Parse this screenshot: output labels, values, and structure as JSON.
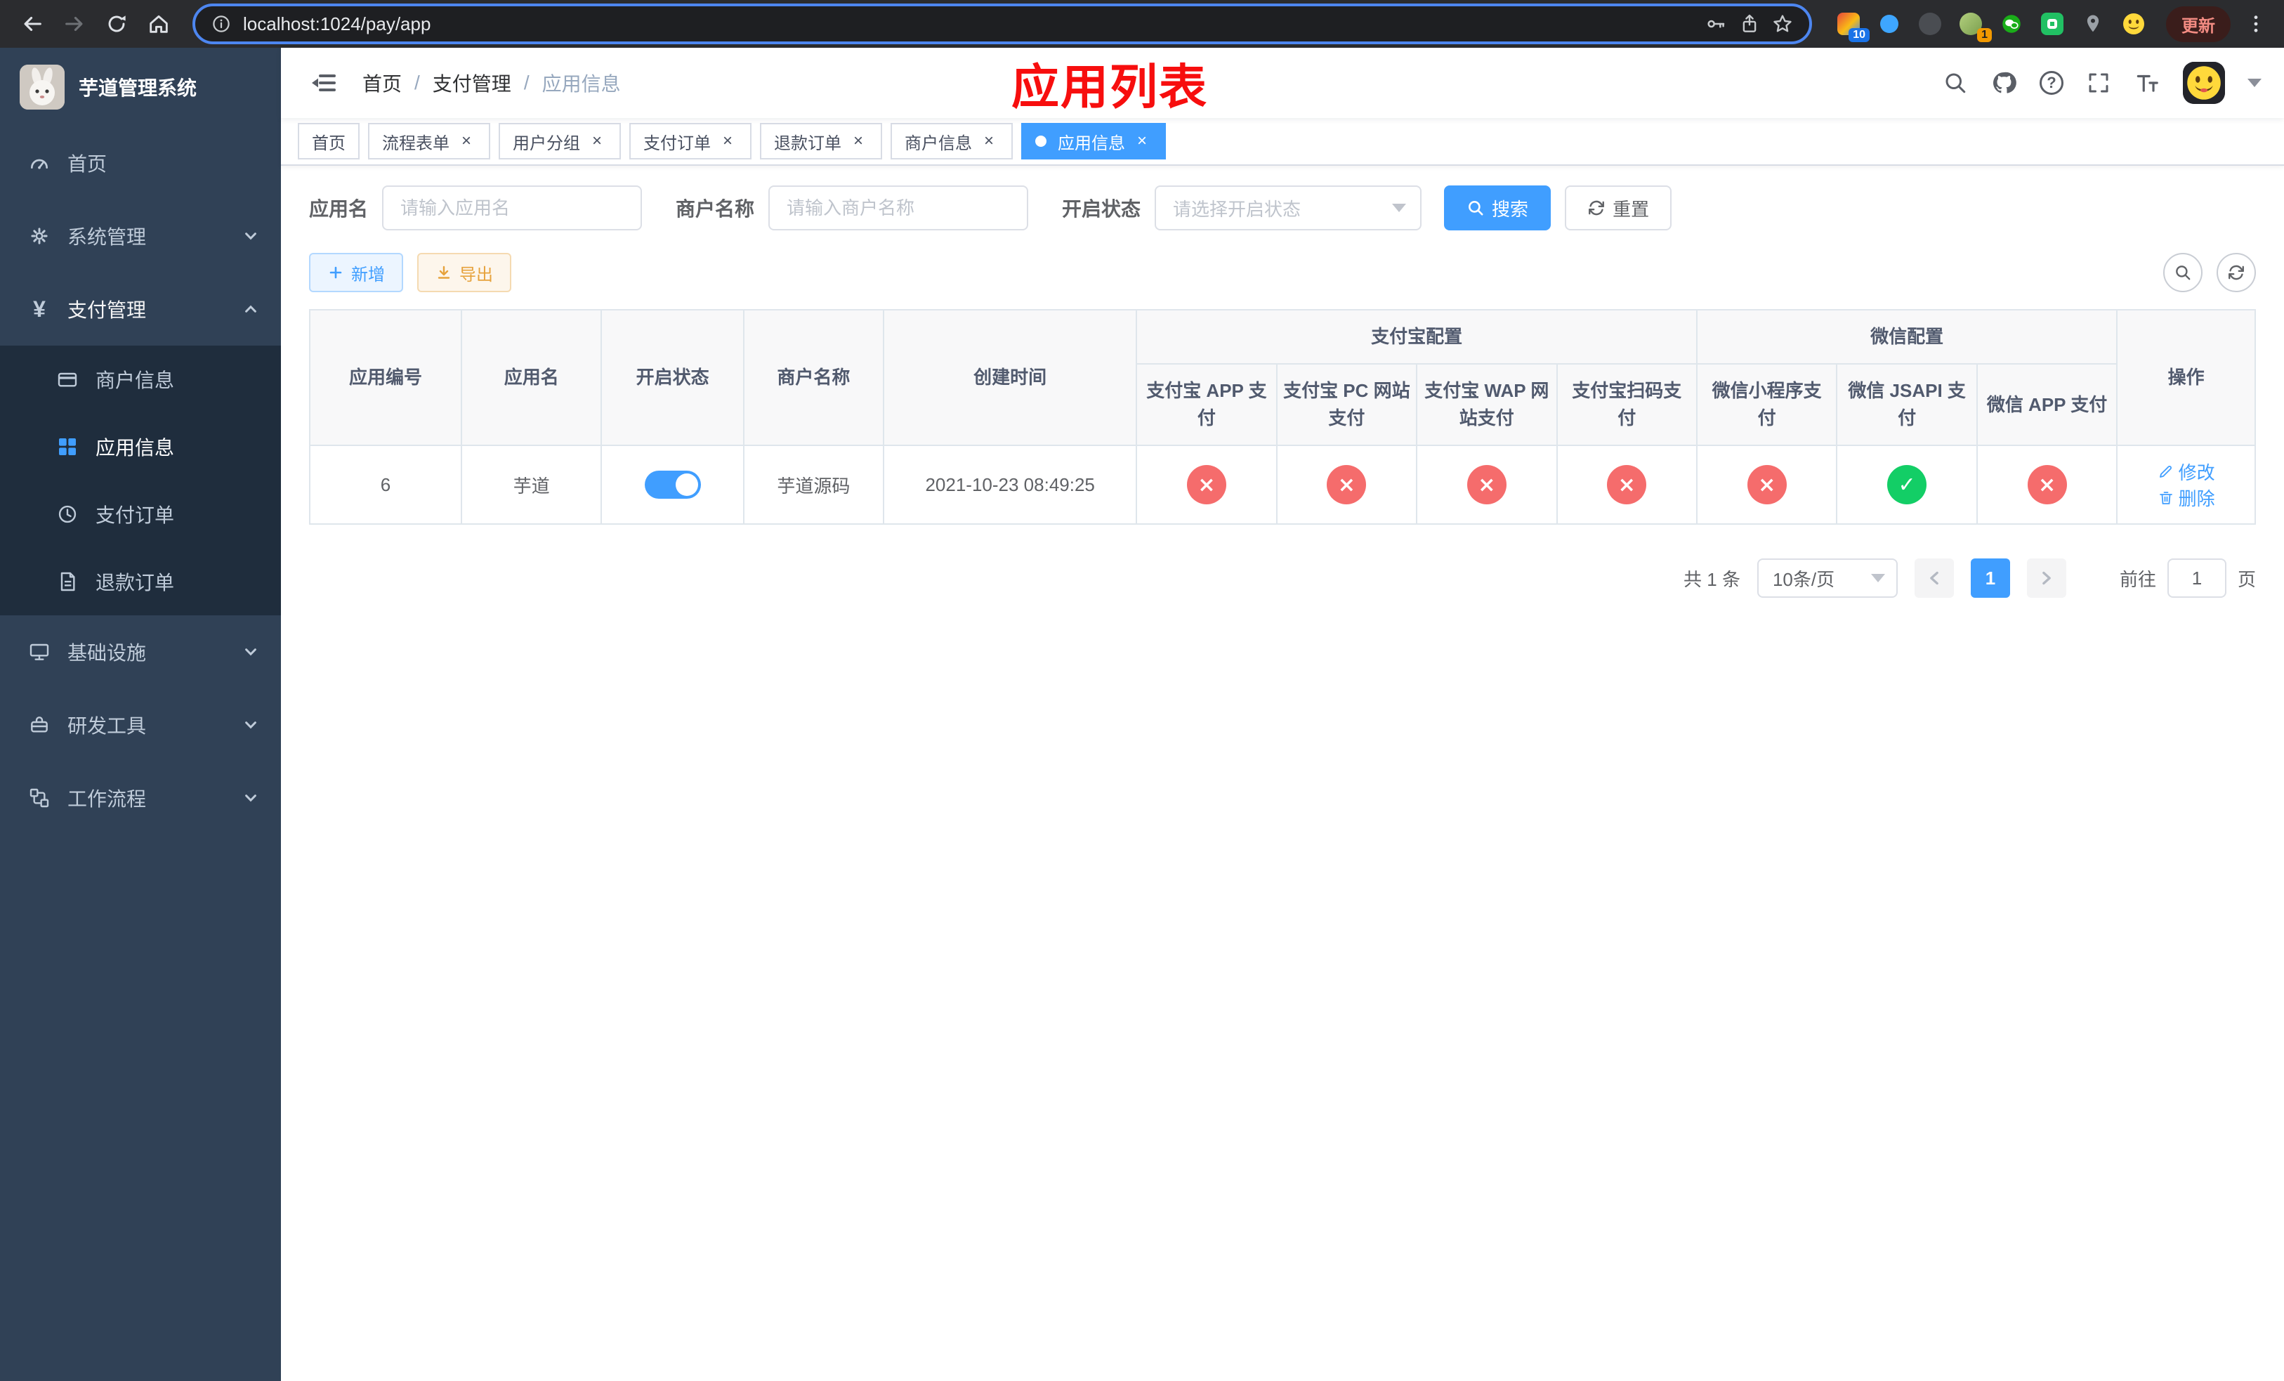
{
  "colors": {
    "accent": "#409eff",
    "success": "#13ce66",
    "danger": "#f56c6c",
    "warning": "#e6a23c",
    "sidebar": "#304156",
    "submenu": "#1f2d3d"
  },
  "icons": {
    "close": "×",
    "check": "✓",
    "cross": "×",
    "question": "?",
    "yen": "¥"
  },
  "browser": {
    "url": "localhost:1024/pay/app",
    "update_label": "更新",
    "extension_badge_count": "10",
    "profile_badge_count": "1"
  },
  "sidebar": {
    "title": "芋道管理系统",
    "items": [
      {
        "label": "首页"
      },
      {
        "label": "系统管理"
      },
      {
        "label": "支付管理",
        "children": [
          {
            "label": "商户信息"
          },
          {
            "label": "应用信息"
          },
          {
            "label": "支付订单"
          },
          {
            "label": "退款订单"
          }
        ]
      },
      {
        "label": "基础设施"
      },
      {
        "label": "研发工具"
      },
      {
        "label": "工作流程"
      }
    ]
  },
  "navbar": {
    "breadcrumb": [
      {
        "label": "首页"
      },
      {
        "label": "支付管理"
      },
      {
        "label": "应用信息"
      }
    ],
    "breadcrumb_separator": "/",
    "annotation": "应用列表"
  },
  "tabs": [
    {
      "label": "首页"
    },
    {
      "label": "流程表单"
    },
    {
      "label": "用户分组"
    },
    {
      "label": "支付订单"
    },
    {
      "label": "退款订单"
    },
    {
      "label": "商户信息"
    },
    {
      "label": "应用信息"
    }
  ],
  "filters": {
    "app_name": {
      "label": "应用名",
      "placeholder": "请输入应用名"
    },
    "merchant_name": {
      "label": "商户名称",
      "placeholder": "请输入商户名称"
    },
    "status": {
      "label": "开启状态",
      "placeholder": "请选择开启状态"
    },
    "search_label": "搜索",
    "reset_label": "重置"
  },
  "toolbar": {
    "add_label": "新增",
    "export_label": "导出"
  },
  "table": {
    "groups": {
      "alipay": "支付宝配置",
      "wechat": "微信配置"
    },
    "columns": {
      "id": "应用编号",
      "name": "应用名",
      "enabled": "开启状态",
      "merchant": "商户名称",
      "created": "创建时间",
      "alipay_app": "支付宝 APP 支付",
      "alipay_pc": "支付宝 PC 网站支付",
      "alipay_wap": "支付宝 WAP 网站支付",
      "alipay_qr": "支付宝扫码支付",
      "wx_lite": "微信小程序支付",
      "wx_jsapi": "微信 JSAPI 支付",
      "wx_app": "微信 APP 支付",
      "actions": "操作"
    },
    "rows": [
      {
        "id": "6",
        "name": "芋道",
        "enabled": true,
        "merchant": "芋道源码",
        "created": "2021-10-23 08:49:25",
        "config": {
          "alipay_app": false,
          "alipay_pc": false,
          "alipay_wap": false,
          "alipay_qr": false,
          "wx_lite": false,
          "wx_jsapi": true,
          "wx_app": false
        },
        "actions": {
          "edit": "修改",
          "delete": "删除"
        }
      }
    ]
  },
  "pagination": {
    "total_text": "共 1 条",
    "page_size_text": "10条/页",
    "current_page": "1",
    "goto_label": "前往",
    "goto_value": "1",
    "goto_unit": "页"
  }
}
